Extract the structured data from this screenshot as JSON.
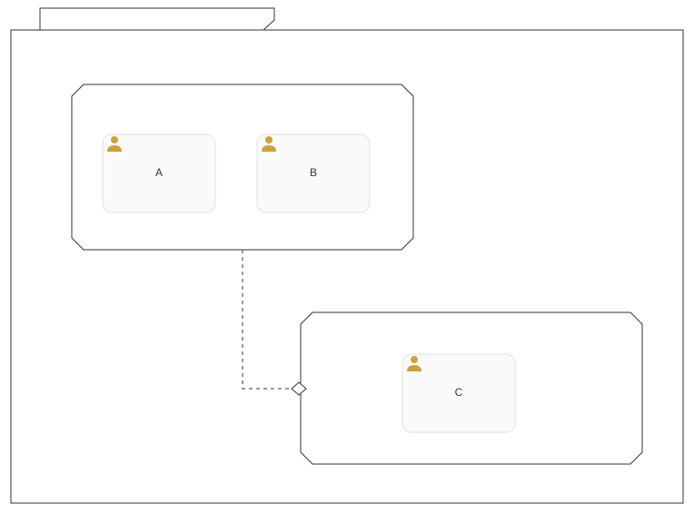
{
  "diagram": {
    "type": "uml-package-swimlane",
    "actors": {
      "a": {
        "label": "A"
      },
      "b": {
        "label": "B"
      },
      "c": {
        "label": "C"
      }
    },
    "colors": {
      "stroke": "#333333",
      "actorFill": "#fafafa",
      "actorStroke": "#e0e0e0",
      "userIcon": "#cba33b",
      "diamondFill": "#ffffff"
    }
  }
}
